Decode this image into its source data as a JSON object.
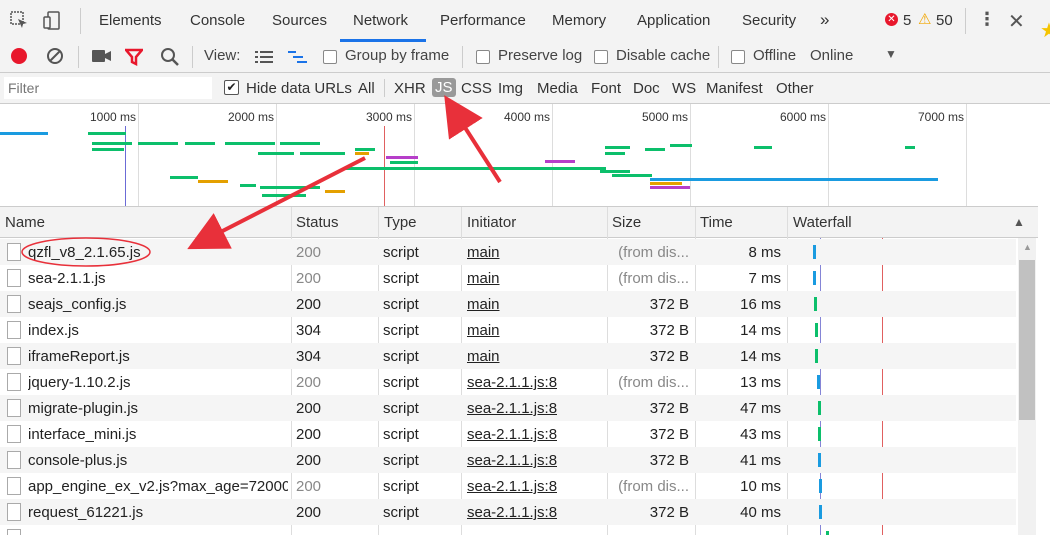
{
  "tabs": [
    "Elements",
    "Console",
    "Sources",
    "Network",
    "Performance",
    "Memory",
    "Application",
    "Security"
  ],
  "tabs_more": "»",
  "errors": {
    "count": "5",
    "warnings": "50"
  },
  "toolbar": {
    "view_label": "View:",
    "group_by_frame": "Group by frame",
    "preserve_log": "Preserve log",
    "disable_cache": "Disable cache",
    "offline": "Offline",
    "throttle": "Online"
  },
  "filter": {
    "placeholder": "Filter",
    "hide_data_urls": "Hide data URLs",
    "types": [
      "All",
      "XHR",
      "JS",
      "CSS",
      "Img",
      "Media",
      "Font",
      "Doc",
      "WS",
      "Manifest",
      "Other"
    ],
    "active_type": "JS"
  },
  "timeline": {
    "ticks": [
      "1000 ms",
      "2000 ms",
      "3000 ms",
      "4000 ms",
      "5000 ms",
      "6000 ms",
      "7000 ms"
    ]
  },
  "table": {
    "columns": [
      "Name",
      "Status",
      "Type",
      "Initiator",
      "Size",
      "Time",
      "Waterfall"
    ],
    "rows": [
      {
        "name": "qzfl_v8_2.1.65.js",
        "status": "200",
        "type": "script",
        "initiator": "main",
        "size": "(from dis...",
        "time": "8 ms"
      },
      {
        "name": "sea-2.1.1.js",
        "status": "200",
        "type": "script",
        "initiator": "main",
        "size": "(from dis...",
        "time": "7 ms"
      },
      {
        "name": "seajs_config.js",
        "status": "200",
        "type": "script",
        "initiator": "main",
        "size": "372 B",
        "time": "16 ms"
      },
      {
        "name": "index.js",
        "status": "304",
        "type": "script",
        "initiator": "main",
        "size": "372 B",
        "time": "14 ms"
      },
      {
        "name": "iframeReport.js",
        "status": "304",
        "type": "script",
        "initiator": "main",
        "size": "372 B",
        "time": "14 ms"
      },
      {
        "name": "jquery-1.10.2.js",
        "status": "200",
        "type": "script",
        "initiator": "sea-2.1.1.js:8",
        "size": "(from dis...",
        "time": "13 ms"
      },
      {
        "name": "migrate-plugin.js",
        "status": "200",
        "type": "script",
        "initiator": "sea-2.1.1.js:8",
        "size": "372 B",
        "time": "47 ms"
      },
      {
        "name": "interface_mini.js",
        "status": "200",
        "type": "script",
        "initiator": "sea-2.1.1.js:8",
        "size": "372 B",
        "time": "43 ms"
      },
      {
        "name": "console-plus.js",
        "status": "200",
        "type": "script",
        "initiator": "sea-2.1.1.js:8",
        "size": "372 B",
        "time": "41 ms"
      },
      {
        "name": "app_engine_ex_v2.js?max_age=72000",
        "status": "200",
        "type": "script",
        "initiator": "sea-2.1.1.js:8",
        "size": "(from dis...",
        "time": "10 ms"
      },
      {
        "name": "request_61221.js",
        "status": "200",
        "type": "script",
        "initiator": "sea-2.1.1.js:8",
        "size": "372 B",
        "time": "40 ms"
      }
    ]
  },
  "colors": {
    "accent": "#1a73e8",
    "record": "#e8172c",
    "filter_icon": "#e8172c",
    "arrow": "#e8303a"
  }
}
